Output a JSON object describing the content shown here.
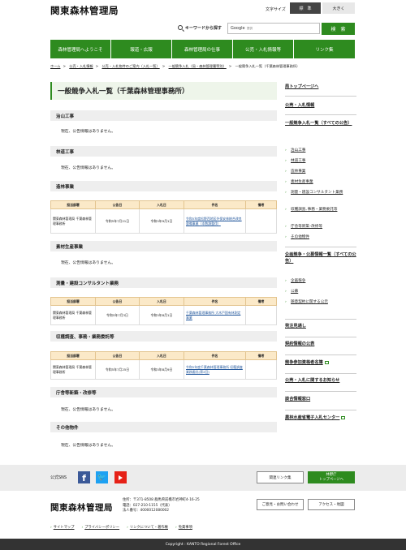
{
  "header": {
    "logo": "関東森林管理局",
    "font_size_label": "文字サイズ",
    "font_size_standard": "標　準",
    "font_size_large": "大きく",
    "search_label": "キーワードから探す",
    "search_placeholder": "Google",
    "search_placeholder_sub": "提供",
    "search_button": "検　索"
  },
  "nav": [
    "森林管理局へようこそ",
    "報道・広報",
    "森林管理局の仕事",
    "公売・入札情報等",
    "リンク集"
  ],
  "breadcrumb": [
    "ホーム",
    "公売・入札情報",
    "公売・入札物件のご案内（入札一覧）",
    "一般競争入札（局・森林管理署等別）",
    "一般競争入札一覧（千葉森林管理事務所）"
  ],
  "page_title": "一般競争入札一覧（千葉森林管理事務所）",
  "no_notice_text": "現在、公告情報はありません。",
  "table_headers": [
    "担当部署",
    "公告日",
    "入札日",
    "件名",
    "備考"
  ],
  "sections": {
    "chisan": {
      "title": "治山工事"
    },
    "rindo": {
      "title": "林道工事"
    },
    "zorin": {
      "title": "造林事業",
      "row": {
        "dept": "関東森林管理局 千葉森林管理事務所",
        "notice": "令和5年7月21日",
        "bid": "令和5年9月1日",
        "subject": "令和5年度松野西地区外保安林総合改良整備事業（本数調整伐）",
        "note": ""
      }
    },
    "sozai": {
      "title": "素材生産事業"
    },
    "sokuryo": {
      "title": "測量・建設コンサルタント業務",
      "row": {
        "dept": "関東森林管理局 千葉森林管理事務所",
        "notice": "令和5年7月3日",
        "bid": "令和5年8月1日",
        "subject": "千葉森林管理事務所 大木戸国有林測定事業",
        "note": ""
      }
    },
    "shuju": {
      "title": "収穫調査、事務・業務委託等",
      "row": {
        "dept": "関東森林管理局 千葉森林管理事務所",
        "notice": "令和5年7月25日",
        "bid": "令和5年8月9日",
        "subject": "令和5年度千葉森林管理事務所 収穫調査業務委託(第2回)",
        "note": ""
      }
    },
    "chosha": {
      "title": "庁舎等新築・改修等"
    },
    "other": {
      "title": "その他物件"
    }
  },
  "sidebar": {
    "top": "局トップページへ",
    "kobai": "公売・入札情報",
    "ippan_all": "一般競争入札一覧（すべての公告）",
    "ippan_items": [
      "治山工事",
      "林道工事",
      "造林事業",
      "素材生産事業",
      "測量・建設コンサルタント業務",
      "収穫調査､事務・業務委託等",
      "庁舎等新築･改修等",
      "その他物件"
    ],
    "kikaku_all": "企画競争・公募情報一覧（すべての公告）",
    "kikaku_items": [
      "企画競争",
      "公募",
      "随意契約に関する公示"
    ],
    "hacchu": "発注見通し",
    "keiyaku": "契約情報の公表",
    "sanka": "競争参加資格者名簿",
    "kobai_oshirase": "公売・入札に関するお知らせ",
    "tokatsu": "談合情報窓口",
    "norin": "農林水産省電子入札センター"
  },
  "footer": {
    "sns_label": "公式SNS",
    "fb": "f",
    "tw": "🐦",
    "links_button": "関連リンク集",
    "rinya_line1": "林野庁",
    "rinya_line2": "トップページへ",
    "logo": "関東森林管理局",
    "address": "住所：〒371-8508 群馬県前橋市岩神町4-16-25",
    "phone": "電話：027-210-1155（代表）",
    "corp_no": "法人番号：4000012080002",
    "contact_button": "ご意見・お問い合わせ",
    "access_button": "アクセス・地図",
    "links": [
      "サイトマップ",
      "プライバシーポリシー",
      "リンクについて・著作権",
      "免責事項"
    ],
    "copyright": "Copyright : KANTO Regional Forest Office"
  },
  "colors": {
    "accent": "#2e8b1f",
    "table_head": "#fbe9c8",
    "section_bg": "#eeeeee"
  }
}
